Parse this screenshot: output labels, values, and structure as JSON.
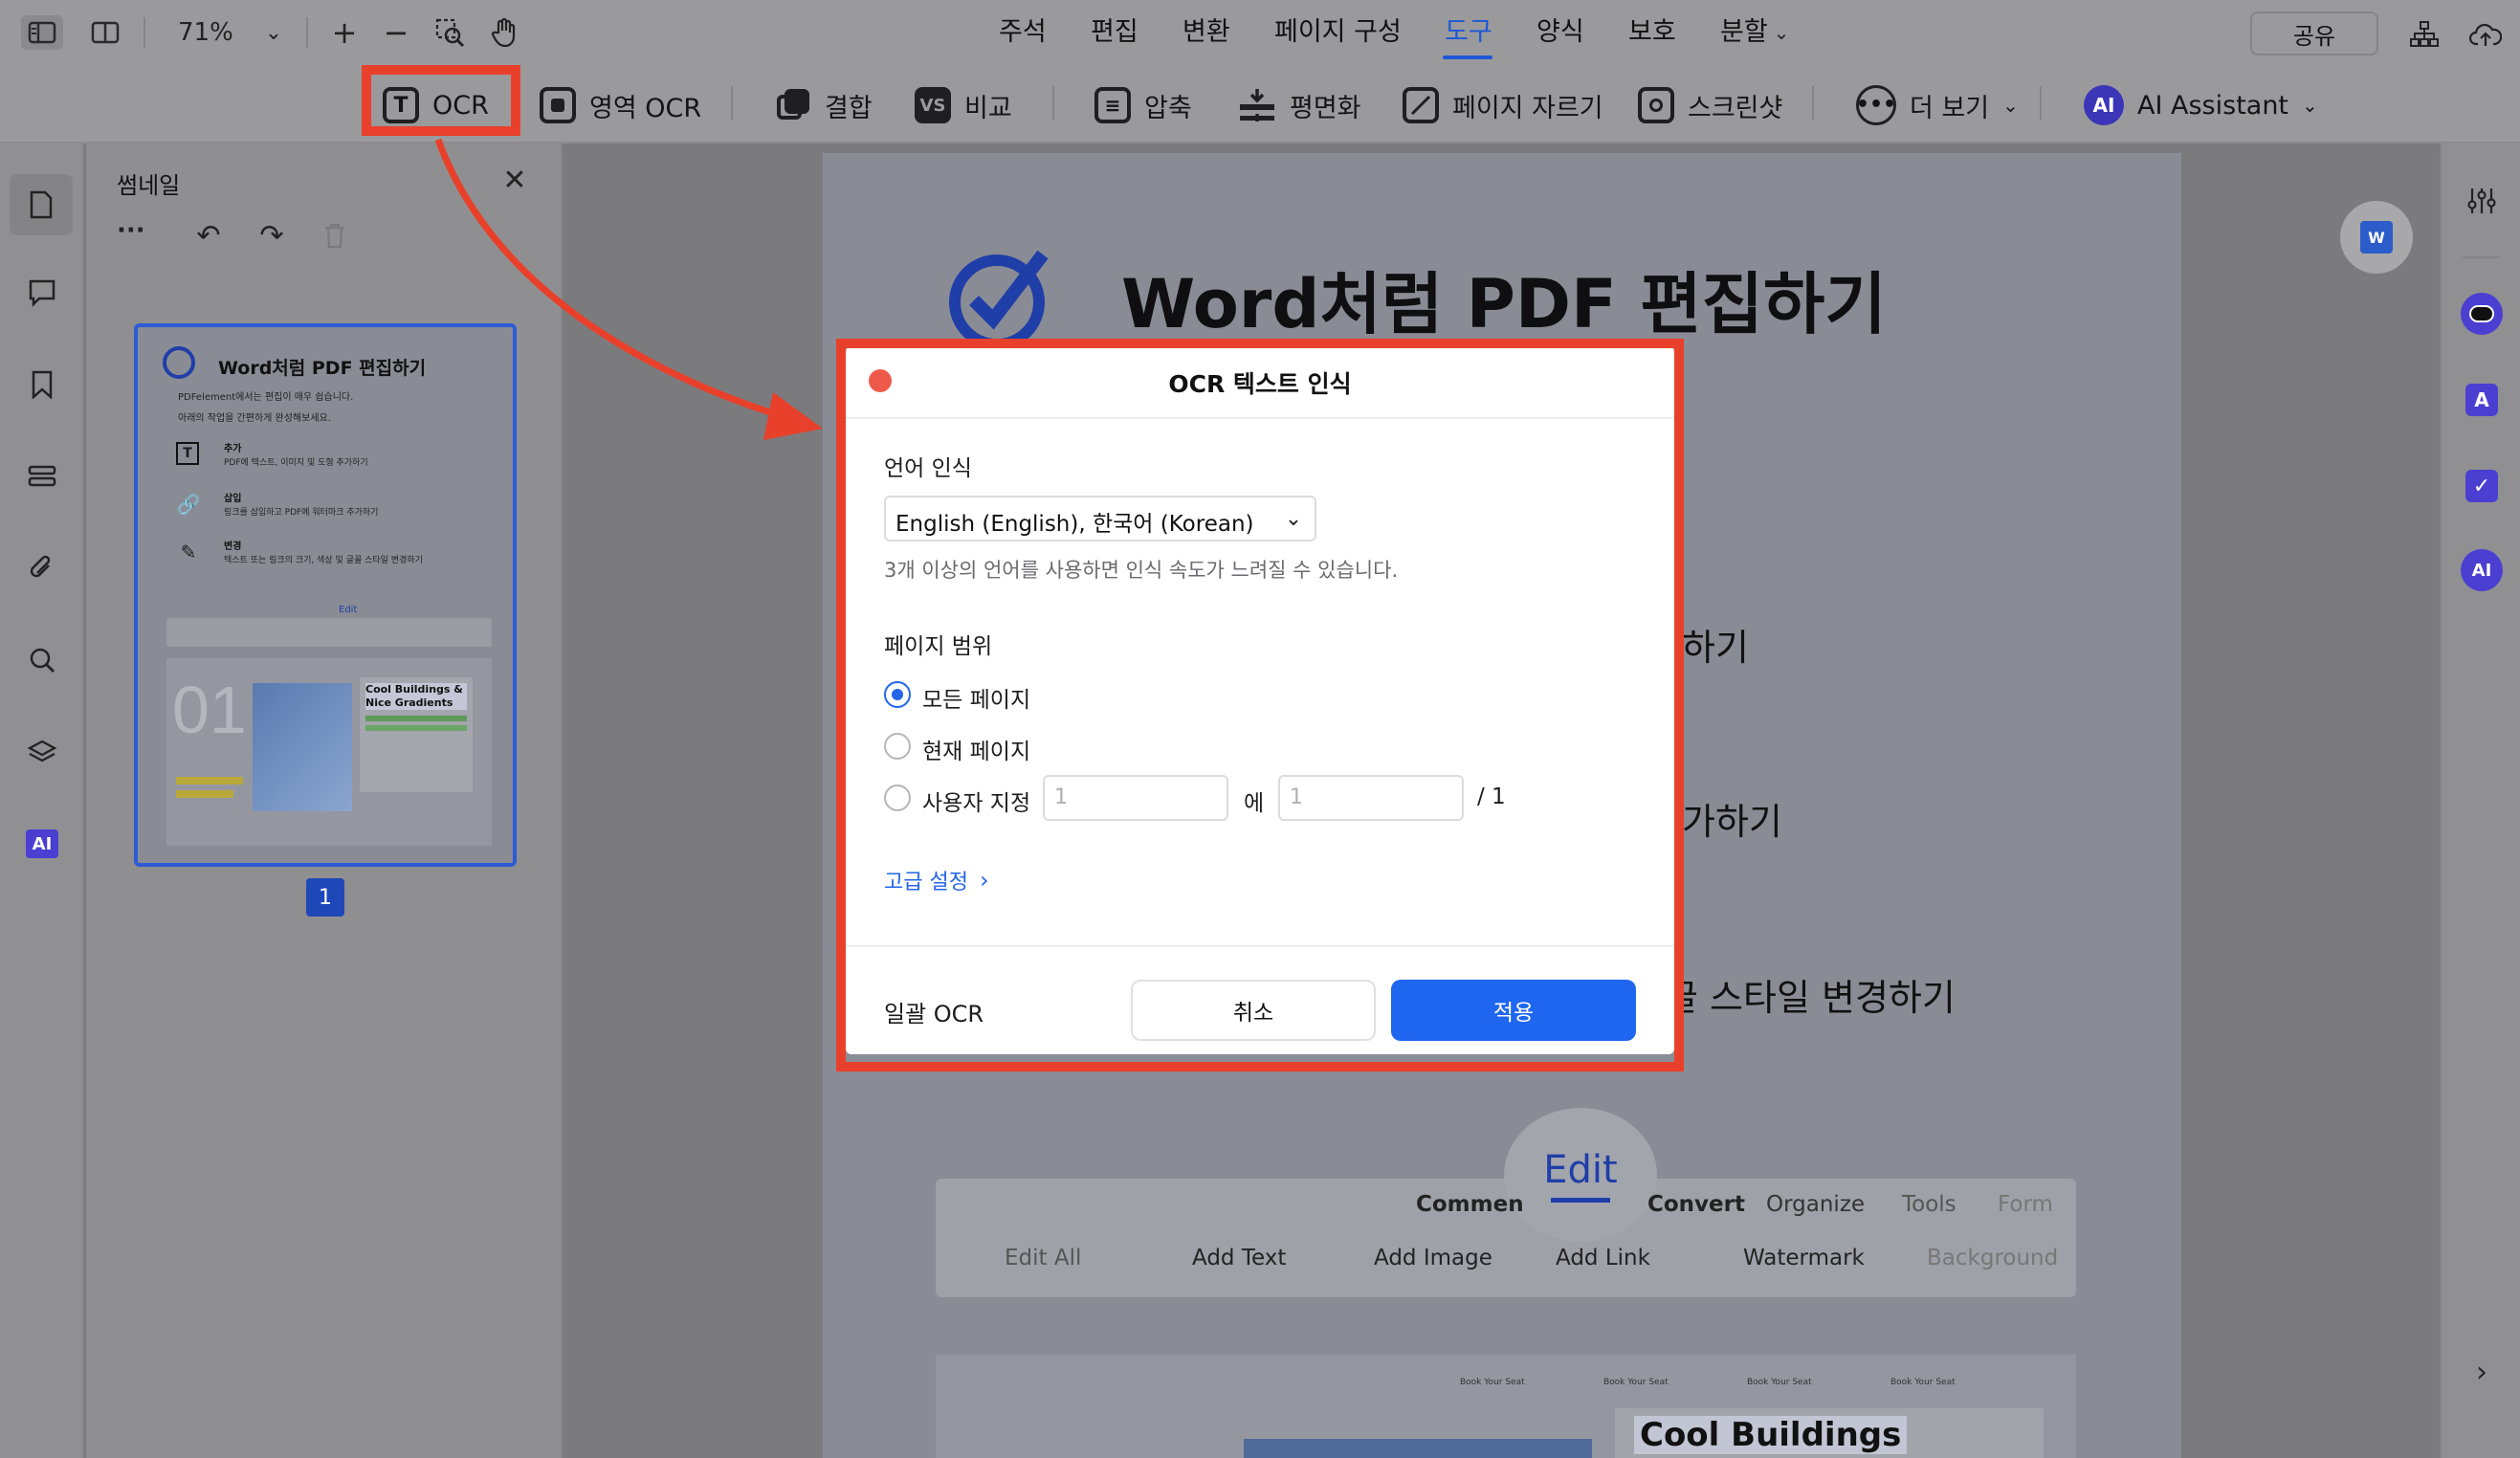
{
  "topbar": {
    "zoom": "71%",
    "menu": [
      "주석",
      "편집",
      "변환",
      "페이지 구성",
      "도구",
      "양식",
      "보호",
      "분할"
    ],
    "active_menu": "도구",
    "share": "공유"
  },
  "toolbar": {
    "items": [
      "OCR",
      "영역 OCR",
      "결합",
      "비교",
      "압축",
      "평면화",
      "페이지 자르기",
      "스크린샷",
      "더 보기",
      "AI Assistant"
    ]
  },
  "thumbnail_panel": {
    "title": "썸네일",
    "more": "···",
    "page_number": "1",
    "thumb": {
      "title": "Word처럼 PDF 편집하기",
      "line1": "PDFelement에서는 편집이 매우 쉽습니다.",
      "line2": "아래의 작업을 간편하게 완성해보세요.",
      "item1_title": "추가",
      "item1_desc": "PDF에 텍스트, 이미지 및 도형 추가하기",
      "item2_title": "삽입",
      "item2_desc": "링크를 삽입하고 PDF에 워터마크 추가하기",
      "item3_title": "변경",
      "item3_desc": "텍스트 또는 링크의 크기, 색상 및 글꼴 스타일 변경하기",
      "edit_label": "Edit",
      "big_number": "01",
      "card_title": "Cool Buildings & Nice Gradients"
    }
  },
  "document": {
    "title": "Word처럼 PDF 편집하기",
    "fragment1": "하기",
    "fragment2": "가하기",
    "fragment3": "글 스타일 변경하기",
    "edit_tab": "Edit",
    "tabs": [
      "Commen",
      "Convert",
      "Organize",
      "Tools",
      "Form"
    ],
    "tools": [
      "Edit All",
      "Add Text",
      "Add Image",
      "Add Link",
      "Watermark",
      "Background"
    ],
    "card_title": "Cool Buildings",
    "small_labels": [
      "Book Your Seat",
      "Book Your Seat",
      "Book Your Seat",
      "Book Your Seat"
    ]
  },
  "dialog": {
    "title": "OCR 텍스트 인식",
    "language_label": "언어 인식",
    "language_value": "English (English), 한국어 (Korean)",
    "language_hint": "3개 이상의 언어를 사용하면 인식 속도가 느려질 수 있습니다.",
    "range_label": "페이지 범위",
    "option_all": "모든 페이지",
    "option_current": "현재 페이지",
    "option_custom": "사용자 지정",
    "from_value": "1",
    "to_word": "에",
    "to_value": "1",
    "total": "/ 1",
    "advanced": "고급 설정",
    "batch": "일괄 OCR",
    "cancel": "취소",
    "apply": "적용"
  },
  "colors": {
    "accent": "#2466e8",
    "highlight": "#e9402b",
    "brand_purple": "#5b4ee6"
  }
}
